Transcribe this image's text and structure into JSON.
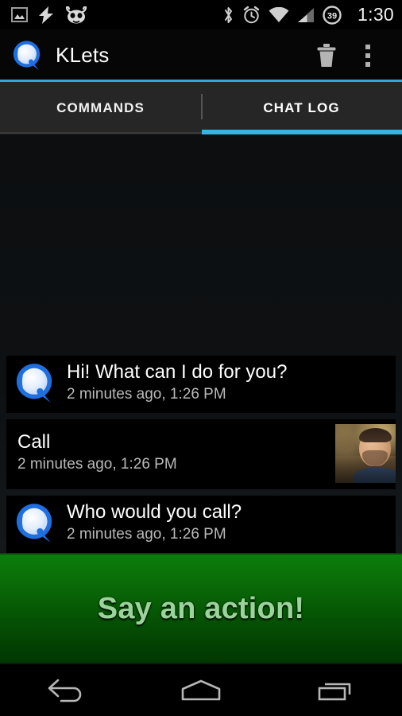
{
  "status_bar": {
    "time": "1:30",
    "battery_level": "39",
    "left_icons": [
      "image-icon",
      "charging-bolt-icon",
      "cyanogenmod-icon"
    ],
    "right_icons": [
      "bluetooth-icon",
      "alarm-clock-icon",
      "wifi-icon",
      "cell-signal-icon",
      "battery-icon"
    ]
  },
  "action_bar": {
    "app_name": "KLets",
    "logo_icon": "klets-logo-icon",
    "delete_icon": "trash-icon",
    "overflow_icon": "overflow-menu-icon",
    "accent_color": "#33b5e5"
  },
  "tabs": {
    "items": [
      {
        "label": "COMMANDS",
        "active": false
      },
      {
        "label": "CHAT LOG",
        "active": true
      }
    ],
    "indicator_color": "#33b5e5"
  },
  "chat": {
    "messages": [
      {
        "sender": "bot",
        "text": "Hi! What can I do for you?",
        "time": "2 minutes ago, 1:26 PM",
        "avatar": "klets-logo-icon"
      },
      {
        "sender": "user",
        "text": "Call",
        "time": "2 minutes ago, 1:26 PM",
        "avatar": "user-photo"
      },
      {
        "sender": "bot",
        "text": "Who would you call?",
        "time": "2 minutes ago, 1:26 PM",
        "avatar": "klets-logo-icon"
      }
    ]
  },
  "action_button": {
    "label": "Say an action!",
    "background_top_color": "#0b7d0b",
    "background_bottom_color": "#013701",
    "text_color": "#9bd49b"
  },
  "nav_bar": {
    "buttons": [
      {
        "name": "back-icon"
      },
      {
        "name": "home-icon"
      },
      {
        "name": "recents-icon"
      }
    ]
  }
}
